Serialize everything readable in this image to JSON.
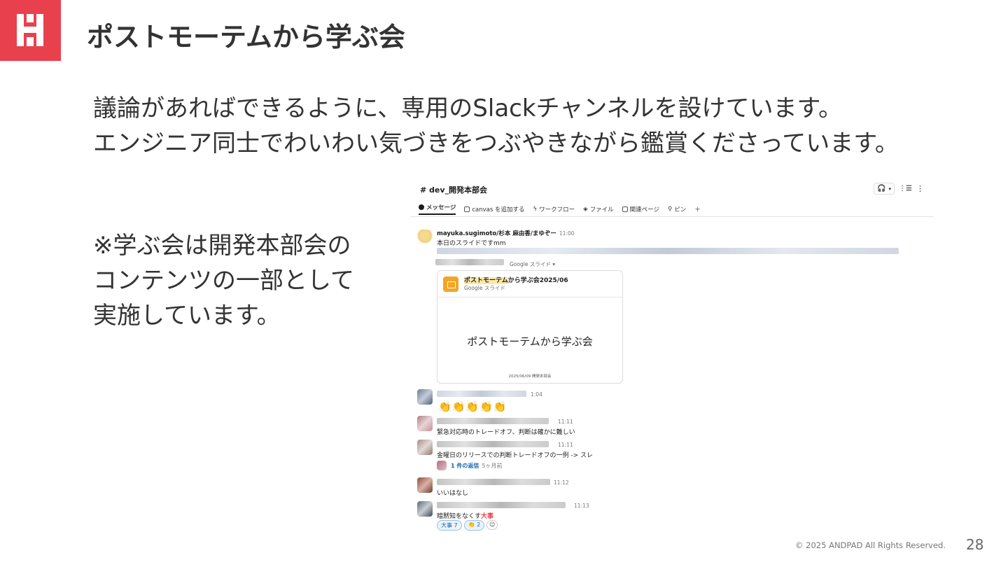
{
  "brand": {
    "accent": "#e8414d",
    "logo_name": "andpad-logo"
  },
  "slide": {
    "title": "ポストモーテムから学ぶ会",
    "intro_line1": "議論があればできるように、専用のSlackチャンネルを設けています。",
    "intro_line2": "エンジニア同士でわいわい気づきをつぶやきながら鑑賞くださっています。",
    "note_line1": "※学ぶ会は開発本部会の",
    "note_line2": "コンテンツの一部として",
    "note_line3": "実施しています。"
  },
  "slack": {
    "channel": "# dev_開発本部会",
    "tabs": [
      "メッセージ",
      "canvas を追加する",
      "ワークフロー",
      "ファイル",
      "関連ページ",
      "ピン",
      "＋"
    ],
    "post": {
      "author": "mayuka.sugimoto/杉本 麻由香/まゆぞー",
      "time": "11:00",
      "text": "本日のスライドですmm",
      "attachment_label": "Google スライド",
      "card_title_highlight": "ポストモーテム",
      "card_title_rest": "から学ぶ会2025/06",
      "card_subtitle": "Google スライド",
      "card_slide_title": "ポストモーテムから学ぶ会",
      "card_slide_footer": "2025/06/09 開発本部会"
    },
    "messages": [
      {
        "time": "1:04",
        "text": "👏👏👏👏👏"
      },
      {
        "time": "11:11",
        "text": "緊急対応時のトレードオフ、判断は確かに難しい"
      },
      {
        "time": "11:11",
        "text": "金曜日のリリースでの判断トレードオフの一例 -> スレ"
      },
      {
        "time": "11:12",
        "text": "いいはなし"
      },
      {
        "time": "11:13",
        "text": "暗黙知をなくす"
      }
    ],
    "thread_reply": "1 件の返信",
    "thread_ago": "5ヶ月前",
    "stamp_text": "大事",
    "reactions": [
      "大事 7",
      "👏 2"
    ]
  },
  "footer": {
    "copyright": "© 2025 ANDPAD All Rights Reserved.",
    "page": "28"
  }
}
